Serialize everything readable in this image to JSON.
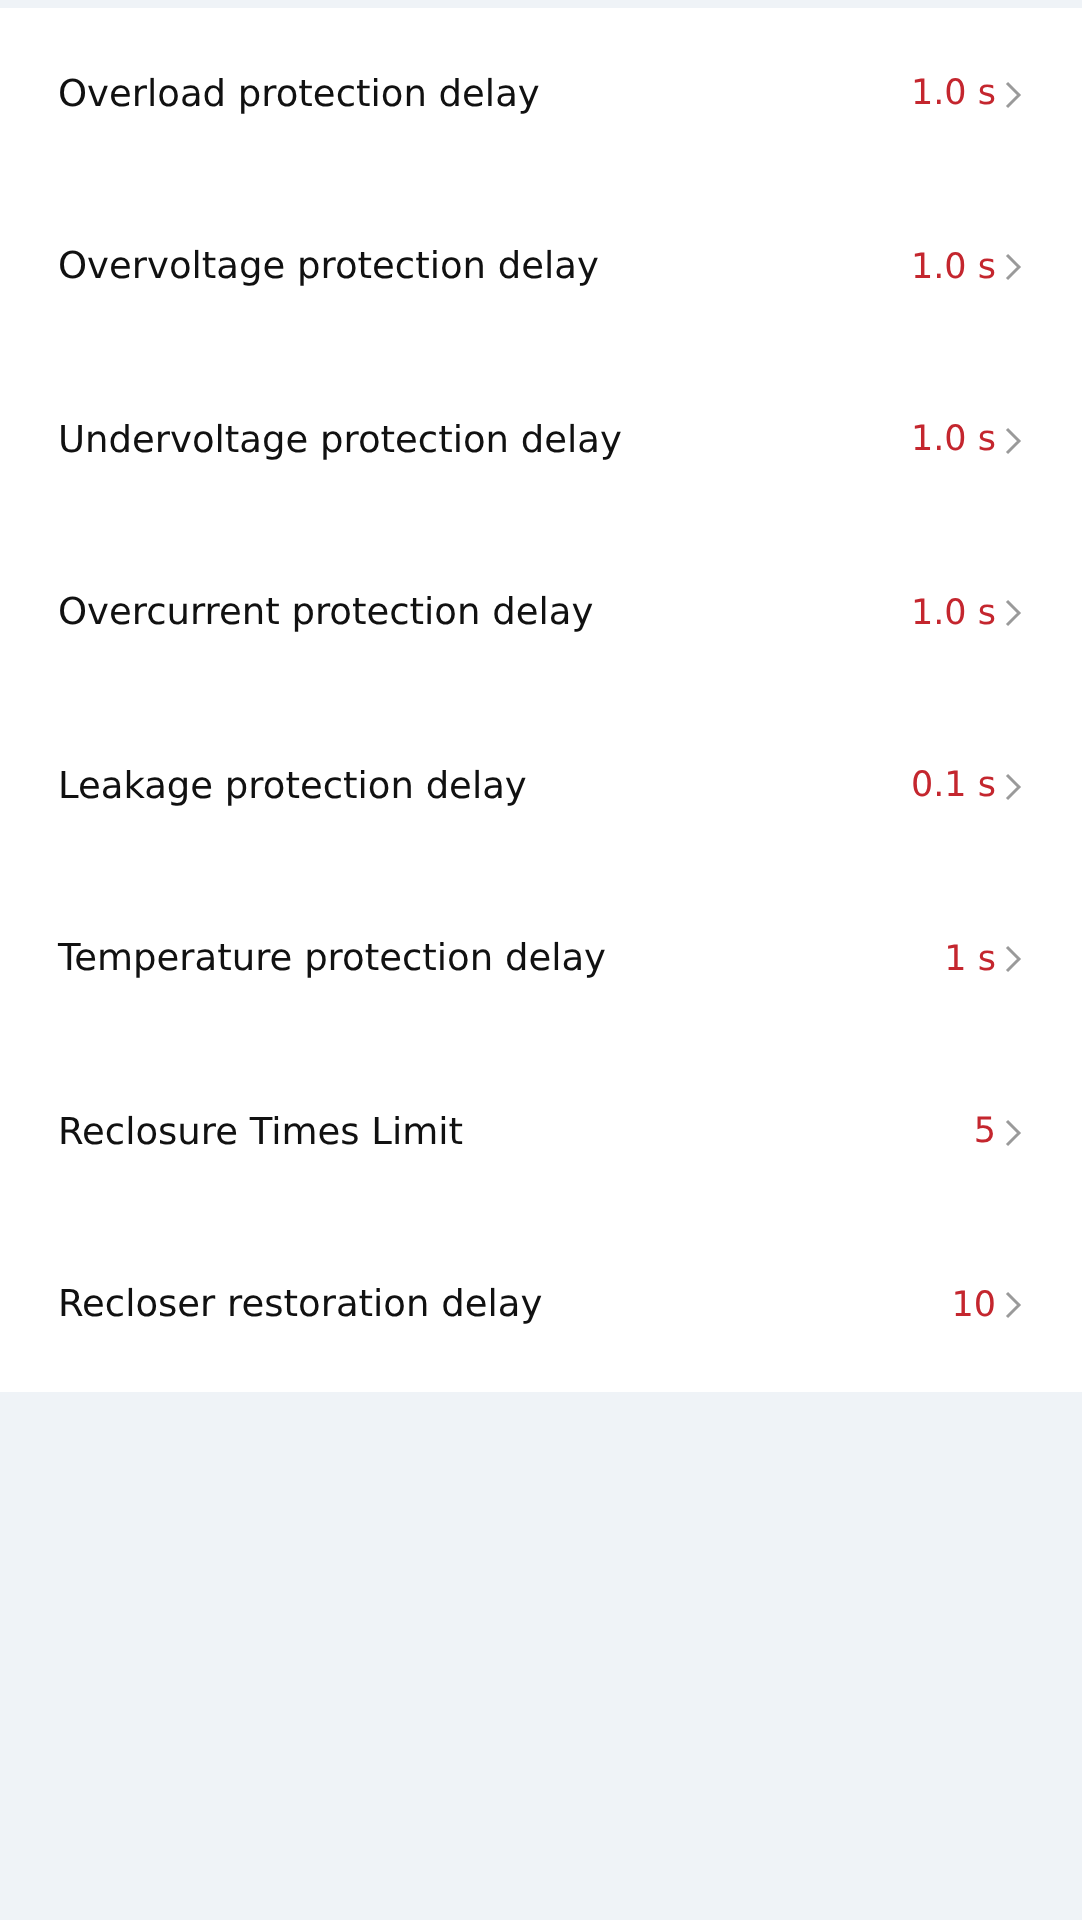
{
  "settings": [
    {
      "label": "Overload protection delay",
      "value": "1.0 s"
    },
    {
      "label": "Overvoltage protection delay",
      "value": "1.0 s"
    },
    {
      "label": "Undervoltage protection delay",
      "value": "1.0 s"
    },
    {
      "label": "Overcurrent protection delay",
      "value": "1.0 s"
    },
    {
      "label": "Leakage protection delay",
      "value": "0.1 s"
    },
    {
      "label": "Temperature protection delay",
      "value": "1 s"
    },
    {
      "label": "Reclosure Times Limit",
      "value": "5"
    },
    {
      "label": "Recloser restoration delay",
      "value": "10"
    }
  ]
}
